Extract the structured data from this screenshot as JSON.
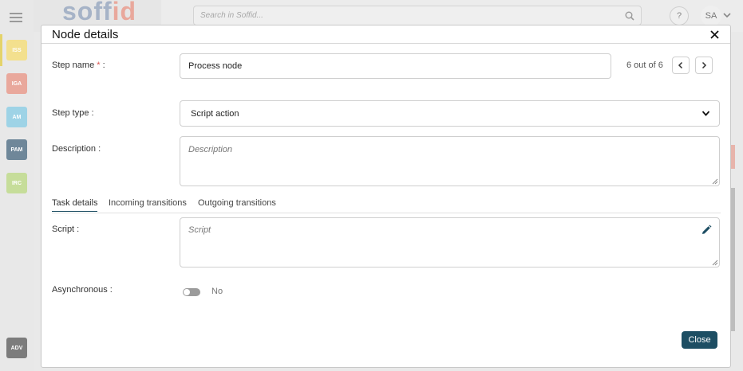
{
  "app": {
    "logo_main": "soff",
    "logo_accent": "id",
    "search_placeholder": "Search in Soffid...",
    "help_label": "?",
    "user_initials": "SA",
    "modules": [
      {
        "label": "ISS",
        "color": "#f3e08e"
      },
      {
        "label": "IGA",
        "color": "#e9a89c"
      },
      {
        "label": "AM",
        "color": "#9ed3e6"
      },
      {
        "label": "PAM",
        "color": "#6f8799"
      },
      {
        "label": "IRC",
        "color": "#c6dd9a"
      },
      {
        "label": "ADV",
        "color": "#7c7c7c"
      }
    ]
  },
  "modal": {
    "title": "Node details",
    "counter": "6 out of 6",
    "step_name": {
      "label": "Step name",
      "required_mark": "*",
      "suffix": " :",
      "value": "Process node"
    },
    "step_type": {
      "label": "Step type :",
      "value": "Script action"
    },
    "description": {
      "label": "Description :",
      "placeholder": "Description"
    },
    "tabs": [
      {
        "label": "Task details",
        "active": true
      },
      {
        "label": "Incoming transitions",
        "active": false
      },
      {
        "label": "Outgoing transitions",
        "active": false
      }
    ],
    "script": {
      "label": "Script :",
      "placeholder": "Script"
    },
    "asynchronous": {
      "label": "Asynchronous :",
      "value_label": "No",
      "enabled": false
    },
    "close_label": "Close"
  },
  "colors": {
    "primary": "#1d4e63",
    "required": "#d9534f"
  }
}
